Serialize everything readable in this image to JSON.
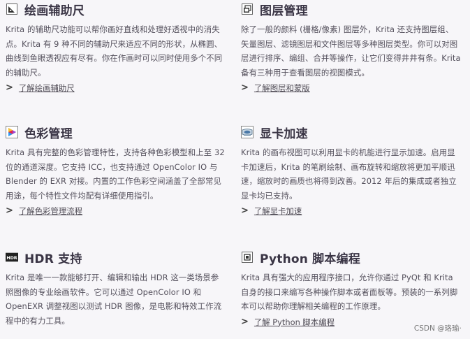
{
  "features": [
    {
      "icon": "ruler-assistant-icon",
      "title": "绘画辅助尺",
      "text": "Krita 的辅助尺功能可以帮你画好直线和处理好透视中的消失点。Krita 有 9 种不同的辅助尺来适应不同的形状，从椭圆、曲线到鱼眼透视应有尽有。你在作画时可以同时使用多个不同的辅助尺。",
      "link": "了解绘画辅助尺"
    },
    {
      "icon": "layers-icon",
      "title": "图层管理",
      "text": "除了一般的颜料 (栅格/像素) 图层外，Krita 还支持图层组、矢量图层、滤镜图层和文件图层等多种图层类型。你可以对图层进行排序、编组、合并等操作，让它们变得井井有条。Krita 备有三种用于查看图层的视图模式。",
      "link": "了解图层和蒙版"
    },
    {
      "icon": "color-management-icon",
      "title": "色彩管理",
      "text": "Krita 具有完整的色彩管理特性，支持各种色彩模型和上至 32 位的通道深度。它支持 ICC，也支持通过 OpenColor IO 与 Blender 的 EXR 对接。内置的工作色彩空间涵盖了全部常见用途，每个特性文件均配有详细使用指引。",
      "link": "了解色彩管理流程"
    },
    {
      "icon": "gpu-card-icon",
      "title": "显卡加速",
      "text": "Krita 的画布视图可以利用显卡的机能进行显示加速。启用显卡加速后，Krita 的笔刷绘制、画布旋转和缩放将更加平顺迅速，缩放时的画质也将得到改善。2012 年后的集成或者独立显卡均已支持。",
      "link": "了解显卡加速"
    },
    {
      "icon": "hdr-icon",
      "icon_text": "HDR",
      "title": "HDR 支持",
      "text": "Krita 是唯一一款能够打开、编辑和输出 HDR 这一类场景参照图像的专业绘画软件。它可以通过 OpenColor IO 和 OpenEXR 调整视图以测试 HDR 图像，是电影和特效工作流程中的有力工具。",
      "link": ""
    },
    {
      "icon": "python-script-icon",
      "title": "Python 脚本编程",
      "text": "Krita 具有强大的应用程序接口，允许你通过 PyQt 和 Krita 自身的接口来编写各种操作脚本或者面板等。预装的一系列脚本可以帮助你理解相关编程的工作原理。",
      "link": "了解 Python 脚本编程"
    }
  ],
  "chevron": ">",
  "watermark": "CSDN @珞瑜·"
}
